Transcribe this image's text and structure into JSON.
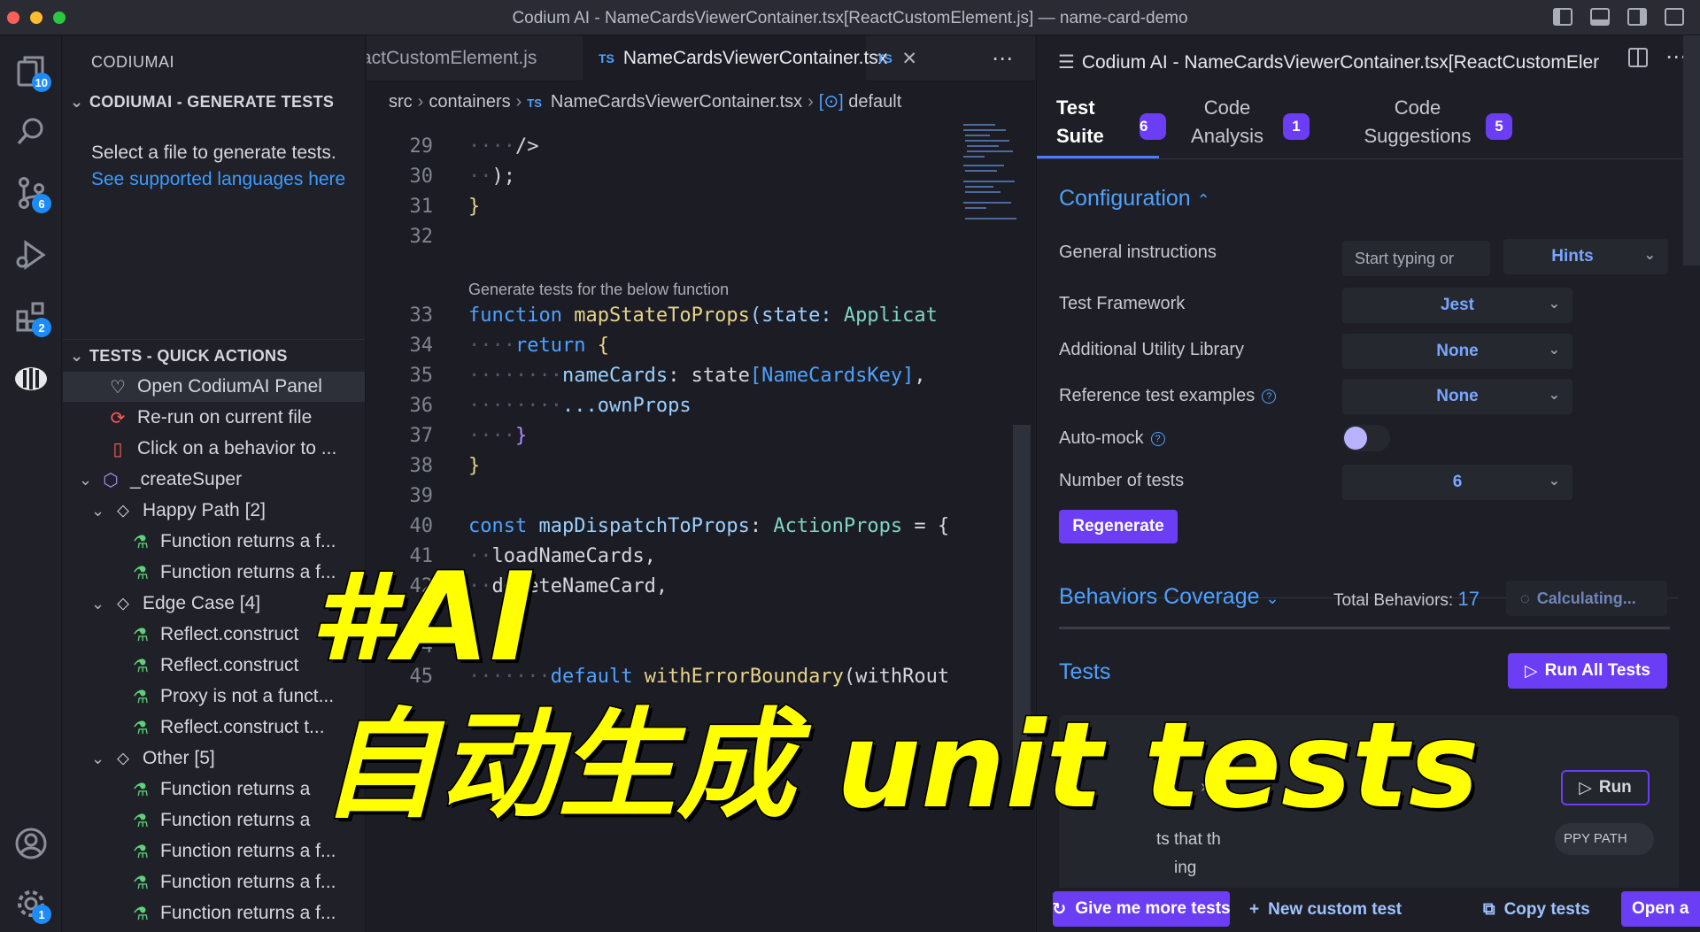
{
  "window": {
    "title": "Codium AI - NameCardsViewerContainer.tsx[ReactCustomElement.js] — name-card-demo"
  },
  "activity": {
    "explorer_badge": "10",
    "scm_badge": "6",
    "extensions_badge": "2",
    "settings_badge": "1"
  },
  "sidebar": {
    "header": "CODIUMAI",
    "generate_section": "CODIUMAI - GENERATE TESTS",
    "generate_text": "Select a file to generate tests.",
    "generate_link": "See supported languages here",
    "quick_section": "TESTS - QUICK ACTIONS",
    "items": [
      {
        "label": "Open CodiumAI Panel",
        "icon": "heart-icon"
      },
      {
        "label": "Re-run on current file",
        "icon": "rerun-icon"
      },
      {
        "label": "Click on a behavior to ...",
        "icon": "file-icon"
      },
      {
        "label": "_createSuper",
        "icon": "cube-icon"
      },
      {
        "label": "Happy Path [2]",
        "icon": "tag-icon"
      },
      {
        "label": "Function returns a f...",
        "icon": "flask-icon"
      },
      {
        "label": "Function returns a f...",
        "icon": "flask-icon"
      },
      {
        "label": "Edge Case [4]",
        "icon": "tag-icon"
      },
      {
        "label": "Reflect.construct",
        "icon": "flask-icon"
      },
      {
        "label": "Reflect.construct",
        "icon": "flask-icon"
      },
      {
        "label": "Proxy is not a funct...",
        "icon": "flask-icon"
      },
      {
        "label": "Reflect.construct t...",
        "icon": "flask-icon"
      },
      {
        "label": "Other [5]",
        "icon": "tag-icon"
      },
      {
        "label": "Function returns a",
        "icon": "flask-icon"
      },
      {
        "label": "Function returns a",
        "icon": "flask-icon"
      },
      {
        "label": "Function returns a f...",
        "icon": "flask-icon"
      },
      {
        "label": "Function returns a f...",
        "icon": "flask-icon"
      },
      {
        "label": "Function returns a f...",
        "icon": "flask-icon"
      }
    ]
  },
  "editor": {
    "tabs": [
      "actCustomElement.js",
      "NameCardsViewerContainer.tsx",
      "TS"
    ],
    "ts_label": "TS",
    "breadcrumb": [
      "src",
      "containers",
      "NameCardsViewerContainer.tsx",
      "default"
    ],
    "codelens": "Generate tests for the below function",
    "line_numbers": [
      "29",
      "30",
      "31",
      "32",
      "33",
      "34",
      "35",
      "36",
      "37",
      "38",
      "39",
      "40",
      "41",
      "42",
      "43",
      "44",
      "45"
    ],
    "code": {
      "l29": "/>",
      "l30": ");",
      "l31": "}",
      "l33_kw": "function",
      "l33_fn": "mapStateToProps",
      "l33_param": "(state: ",
      "l33_ty": "Applicat",
      "l34_kw": "return",
      "l34_rest": " {",
      "l35_prop": "nameCards",
      "l35_rest": ": state",
      "l35_key": "[NameCardsKey]",
      "l35_end": ",",
      "l36": "...ownProps",
      "l37": "}",
      "l38": "}",
      "l40_kw": "const",
      "l40_var": "mapDispatchToProps",
      "l40_colon": ": ",
      "l40_ty": "ActionProps",
      "l40_eq": " = {",
      "l41": "loadNameCards,",
      "l42": "deleteNameCard,",
      "l45_kw": "default",
      "l45_fn": "withErrorBoundary",
      "l45_rest": "(withRout"
    }
  },
  "panel": {
    "title": "Codium AI - NameCardsViewerContainer.tsx[ReactCustomEler",
    "tabs": [
      {
        "line1": "Test",
        "line2": "Suite",
        "count": "6"
      },
      {
        "line1": "Code",
        "line2": "Analysis",
        "count": "1"
      },
      {
        "line1": "Code",
        "line2": "Suggestions",
        "count": "5"
      }
    ],
    "configuration": {
      "title": "Configuration",
      "general_instructions_label": "General instructions",
      "general_instructions_placeholder": "Start typing or",
      "hints_label": "Hints",
      "framework_label": "Test Framework",
      "framework_value": "Jest",
      "utility_label": "Additional Utility Library",
      "utility_value": "None",
      "reference_label": "Reference test examples",
      "reference_value": "None",
      "automock_label": "Auto-mock",
      "number_label": "Number of tests",
      "number_value": "6",
      "regenerate": "Regenerate"
    },
    "behaviors": {
      "title": "Behaviors Coverage",
      "total_label": "Total Behaviors:",
      "total_value": "17",
      "calculating": "Calculating..."
    },
    "tests": {
      "title": "Tests",
      "run_all": "Run All Tests",
      "run": "Run",
      "card_text1": "ts that th",
      "card_text2": "ing",
      "badge": "PPY PATH"
    },
    "bottom": {
      "more": "Give me more tests",
      "custom": "New custom test",
      "copy": "Copy tests",
      "open": "Open a"
    }
  },
  "overlay": {
    "line1": "#AI",
    "line2": "自动生成 unit tests"
  },
  "colors": {
    "accent": "#6b3df5",
    "link": "#4ea1ff",
    "overlay": "#ffff00"
  }
}
